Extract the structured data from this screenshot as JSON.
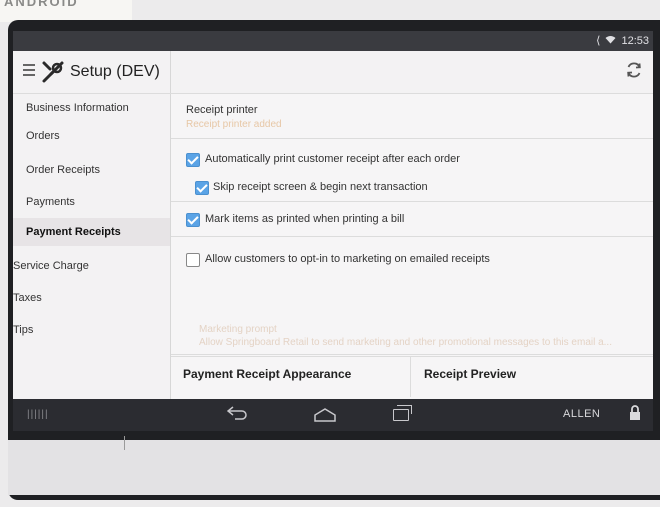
{
  "background_note_text": "ANDROID",
  "status": {
    "time": "12:53"
  },
  "appbar": {
    "title": "Setup (DEV)"
  },
  "sidebar": {
    "items": [
      {
        "label": "Business Information",
        "active": false
      },
      {
        "label": "Orders",
        "active": false
      },
      {
        "label": "Order Receipts",
        "active": false
      },
      {
        "label": "Payments",
        "active": false
      },
      {
        "label": "Payment Receipts",
        "active": true
      },
      {
        "label": "Service Charge",
        "active": false
      },
      {
        "label": "Taxes",
        "active": false
      },
      {
        "label": "Tips",
        "active": false
      }
    ]
  },
  "content": {
    "receipt_printer": {
      "title": "Receipt printer",
      "subtitle": "Receipt printer added"
    },
    "options": {
      "auto_print": {
        "label": "Automatically print customer receipt after each order",
        "checked": true
      },
      "skip_screen": {
        "label": "Skip receipt screen & begin next transaction",
        "checked": true
      },
      "mark_printed": {
        "label": "Mark items as printed when printing a bill",
        "checked": true
      },
      "marketing_optin": {
        "label": "Allow customers to opt-in to marketing on emailed receipts",
        "checked": false
      }
    },
    "marketing_prompt": {
      "title": "Marketing prompt",
      "description": "Allow Springboard Retail to send marketing and other promotional messages to this email a..."
    },
    "sections": {
      "appearance": "Payment Receipt Appearance",
      "preview": "Receipt Preview"
    }
  },
  "navbar": {
    "user": "ALLEN"
  },
  "colors": {
    "checkbox_checked": "#5aa3e6",
    "faded_text": "#e4d3c5",
    "status_bar": "#3a3b40"
  }
}
